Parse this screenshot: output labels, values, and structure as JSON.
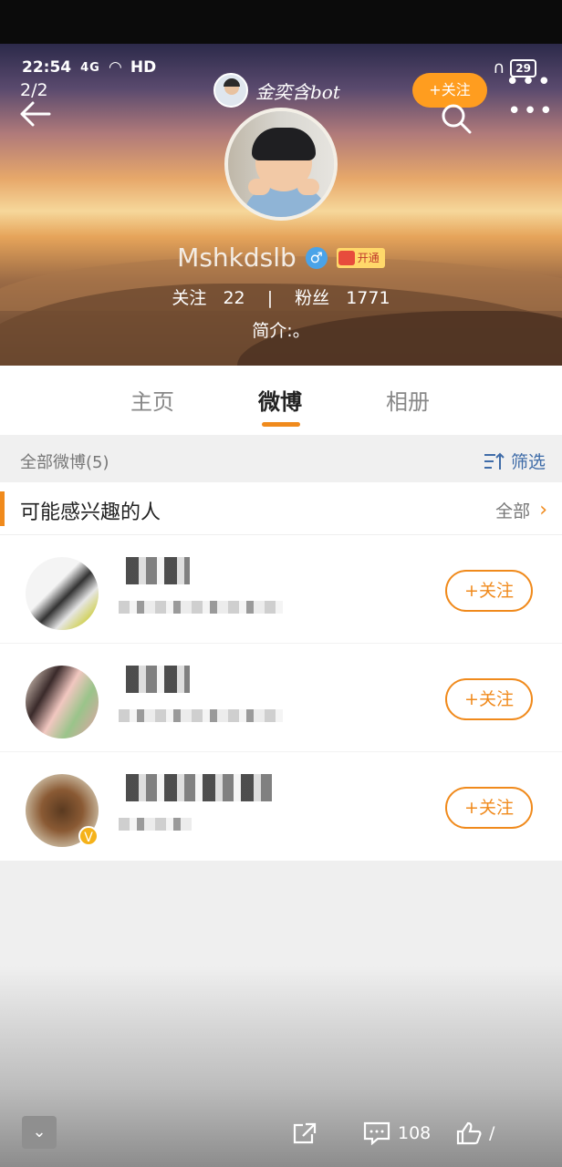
{
  "status_bar": {
    "time": "22:54",
    "signal": "4G",
    "network": "HD",
    "battery": "29",
    "page_index": "2/2"
  },
  "mini_header": {
    "name": "金奕含bot",
    "follow_label": "+关注"
  },
  "profile": {
    "username": "Mshkdslb",
    "gender_symbol": "♂",
    "vip_label": "开通",
    "following_label": "关注",
    "following_count": "22",
    "followers_label": "粉丝",
    "followers_count": "1771",
    "separator": "|",
    "bio": "简介:。"
  },
  "tabs": [
    {
      "label": "主页"
    },
    {
      "label": "微博"
    },
    {
      "label": "相册"
    }
  ],
  "filter_bar": {
    "count_label": "全部微博(5)",
    "filter_label": "筛选"
  },
  "suggestions": {
    "title": "可能感兴趣的人",
    "all_label": "全部",
    "users": [
      {
        "follow_label": "+关注"
      },
      {
        "follow_label": "+关注"
      },
      {
        "follow_label": "+关注",
        "verified_badge": "V"
      }
    ]
  },
  "bottom_bar": {
    "collapse_icon": "chevron-down-icon",
    "share_icon": "share-icon",
    "comment_icon": "comment-icon",
    "comment_count": "108",
    "like_icon": "like-icon",
    "like_count": "/"
  },
  "colors": {
    "accent": "#f08a1c",
    "link": "#3f6ca8",
    "gender": "#4aa3e8"
  }
}
